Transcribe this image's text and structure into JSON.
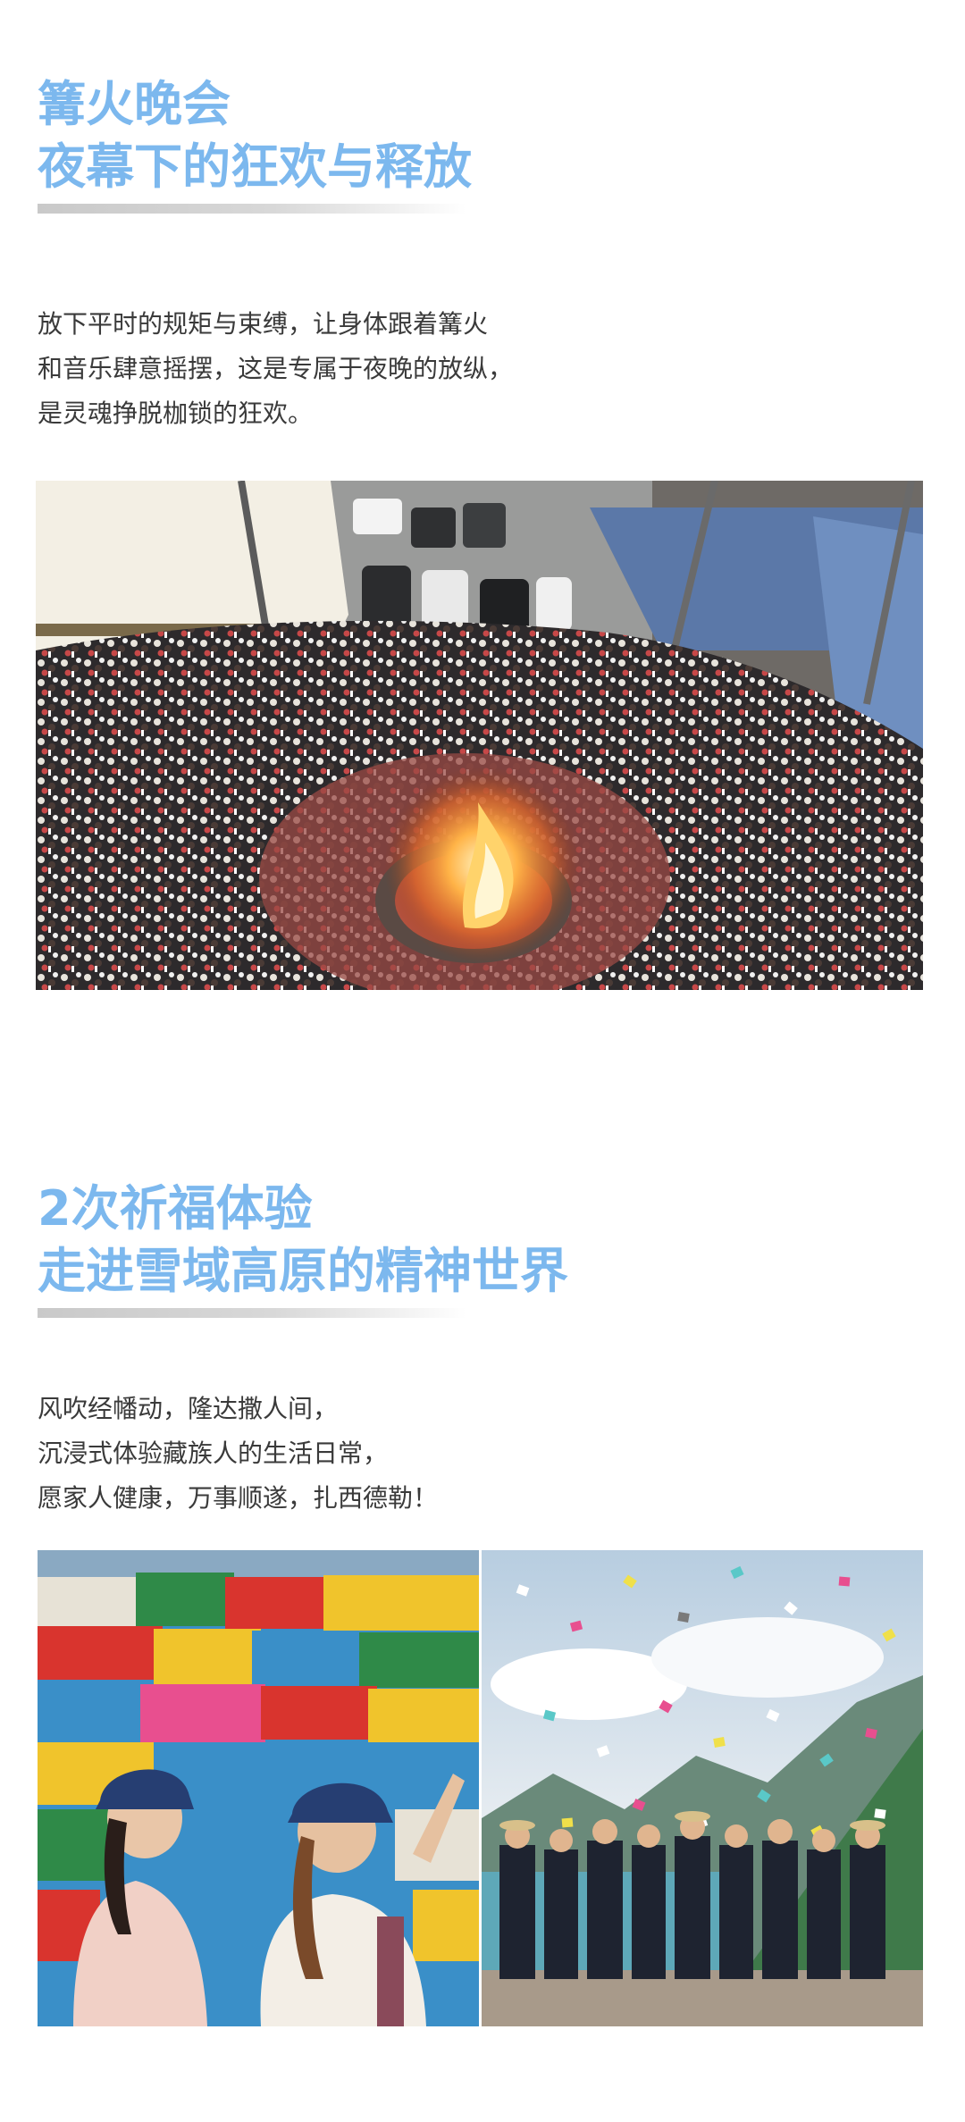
{
  "section1": {
    "title_line1": "篝火晚会",
    "title_line2": "夜幕下的狂欢与释放",
    "body": [
      "放下平时的规矩与束缚，让身体跟着篝火",
      "和音乐肆意摇摆，这是专属于夜晚的放纵，",
      "是灵魂挣脱枷锁的狂欢。"
    ],
    "photo_subject": "bonfire-crowd-photo"
  },
  "section2": {
    "title_line1": "2次祈福体验",
    "title_line2": "走进雪域高原的精神世界",
    "body": [
      "风吹经幡动，隆达撒人间，",
      "沉浸式体验藏族人的生活日常，",
      "愿家人健康，万事顺遂，扎西德勒！"
    ],
    "photo_left_subject": "prayer-flags-photo",
    "photo_right_subject": "lungta-throwing-photo"
  },
  "colors": {
    "heading": "#7cb8ee",
    "body_text": "#3a3a3a",
    "underline": "#cccccc",
    "background": "#ffffff"
  }
}
